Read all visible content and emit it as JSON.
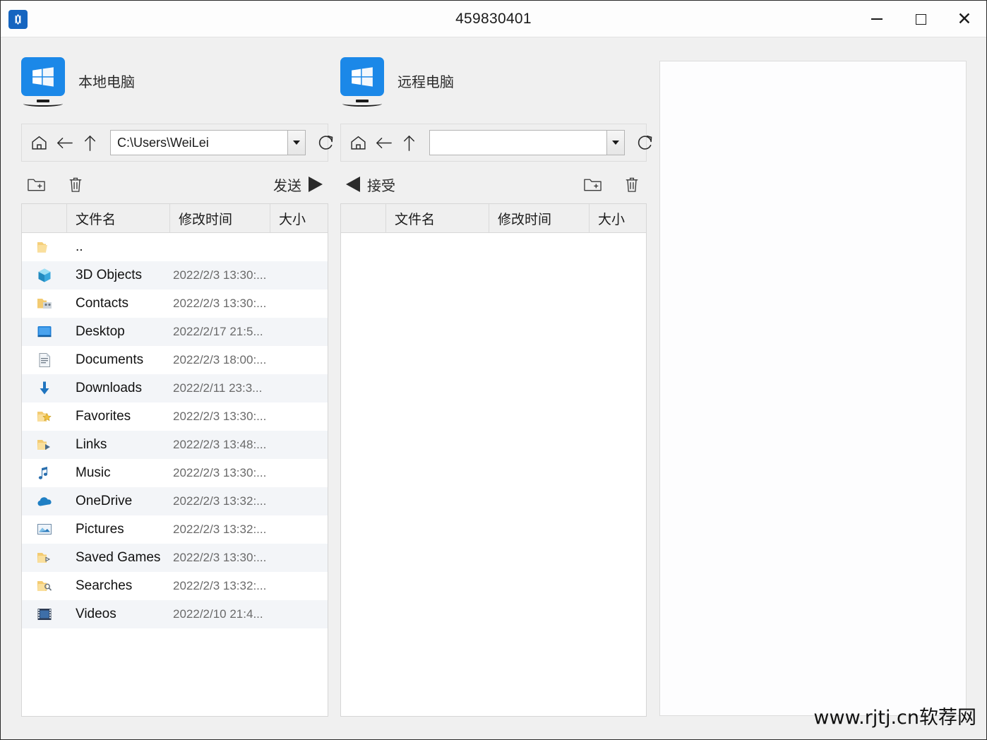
{
  "window": {
    "title": "459830401",
    "logo_icon": "app-logo-icon",
    "minimize_label": "−",
    "maximize_label": "□",
    "close_label": "✕"
  },
  "local": {
    "header_label": "本地电脑",
    "header_icon": "windows-monitor-icon",
    "nav": {
      "home_icon": "home-icon",
      "back_icon": "back-arrow-icon",
      "up_icon": "up-arrow-icon",
      "refresh_icon": "refresh-icon",
      "path_value": "C:\\Users\\WeiLei",
      "path_placeholder": "",
      "dropdown_icon": "chevron-down-icon"
    },
    "actions": {
      "new_folder_icon": "new-folder-icon",
      "delete_icon": "trash-icon",
      "transfer_label": "发送",
      "transfer_icon": "arrow-right-icon"
    },
    "columns": [
      "",
      "文件名",
      "修改时间",
      "大小"
    ],
    "rows": [
      {
        "icon": "folder-up-icon",
        "name": "..",
        "modified": "",
        "size": ""
      },
      {
        "icon": "3d-objects-icon",
        "name": "3D Objects",
        "modified": "2022/2/3 13:30:...",
        "size": ""
      },
      {
        "icon": "contacts-icon",
        "name": "Contacts",
        "modified": "2022/2/3 13:30:...",
        "size": ""
      },
      {
        "icon": "desktop-icon",
        "name": "Desktop",
        "modified": "2022/2/17 21:5...",
        "size": ""
      },
      {
        "icon": "documents-icon",
        "name": "Documents",
        "modified": "2022/2/3 18:00:...",
        "size": ""
      },
      {
        "icon": "downloads-icon",
        "name": "Downloads",
        "modified": "2022/2/11 23:3...",
        "size": ""
      },
      {
        "icon": "favorites-icon",
        "name": "Favorites",
        "modified": "2022/2/3 13:30:...",
        "size": ""
      },
      {
        "icon": "links-icon",
        "name": "Links",
        "modified": "2022/2/3 13:48:...",
        "size": ""
      },
      {
        "icon": "music-icon",
        "name": "Music",
        "modified": "2022/2/3 13:30:...",
        "size": ""
      },
      {
        "icon": "onedrive-icon",
        "name": "OneDrive",
        "modified": "2022/2/3 13:32:...",
        "size": ""
      },
      {
        "icon": "pictures-icon",
        "name": "Pictures",
        "modified": "2022/2/3 13:32:...",
        "size": ""
      },
      {
        "icon": "saved-games-icon",
        "name": "Saved Games",
        "modified": "2022/2/3 13:30:...",
        "size": ""
      },
      {
        "icon": "searches-icon",
        "name": "Searches",
        "modified": "2022/2/3 13:32:...",
        "size": ""
      },
      {
        "icon": "videos-icon",
        "name": "Videos",
        "modified": "2022/2/10 21:4...",
        "size": ""
      }
    ]
  },
  "remote": {
    "header_label": "远程电脑",
    "header_icon": "windows-monitor-icon",
    "nav": {
      "home_icon": "home-icon",
      "back_icon": "back-arrow-icon",
      "up_icon": "up-arrow-icon",
      "refresh_icon": "refresh-icon",
      "path_value": "",
      "path_placeholder": "",
      "dropdown_icon": "chevron-down-icon"
    },
    "actions": {
      "new_folder_icon": "new-folder-icon",
      "delete_icon": "trash-icon",
      "transfer_label": "接受",
      "transfer_icon": "arrow-left-icon"
    },
    "columns": [
      "",
      "文件名",
      "修改时间",
      "大小"
    ],
    "rows": []
  },
  "preview": {
    "content": ""
  },
  "watermark": {
    "text": "www.rjtj.cn软荐网"
  },
  "colors": {
    "accent": "#1b88e8",
    "title_bar": "#fdfdfd",
    "window_bg": "#f0f0f0",
    "row_alt": "#f3f5f8",
    "panel_border": "#d6d6d6"
  }
}
